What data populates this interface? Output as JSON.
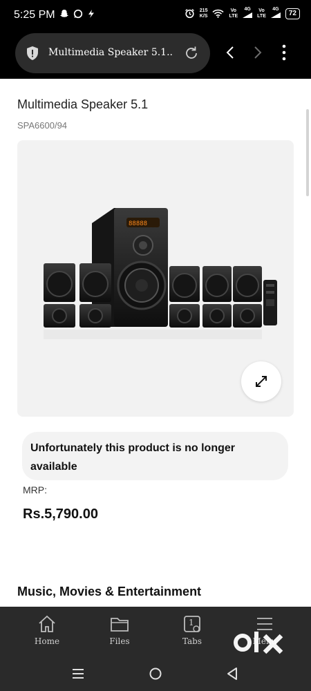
{
  "status_bar": {
    "time": "5:25 PM",
    "net_speed_value": "215",
    "net_speed_unit": "K/S",
    "sim1_tag": "Vo",
    "sim1_sub": "LTE",
    "sim1_gen": "4G",
    "sim2_tag": "Vo",
    "sim2_sub": "LTE",
    "sim2_gen": "4G",
    "battery": "72",
    "icons": [
      "snapchat-icon",
      "whatsapp-icon",
      "messenger-icon",
      "alarm-icon",
      "wifi-icon",
      "signal-icon"
    ]
  },
  "browser": {
    "url_title": "Multimedia Speaker 5.1...",
    "icons": [
      "shield-icon",
      "reload-icon",
      "back-icon",
      "forward-icon",
      "more-icon"
    ]
  },
  "product": {
    "title": "Multimedia Speaker 5.1",
    "sku": "SPA6600/94",
    "unavailable_message": "Unfortunately this product is no longer available",
    "mrp_label": "MRP:",
    "price": "Rs.5,790.00",
    "section_heading": "Music, Movies & Entertainment"
  },
  "toolbar": {
    "home": "Home",
    "files": "Files",
    "tabs": "Tabs",
    "tabs_count": "1",
    "menu": "Menu"
  },
  "watermark": {
    "brand": "olx"
  },
  "colors": {
    "status_bg": "#000000",
    "url_pill": "#2c2c2c",
    "toolbar_bg": "#2a2a2a",
    "card_bg": "#f2f2f2"
  }
}
